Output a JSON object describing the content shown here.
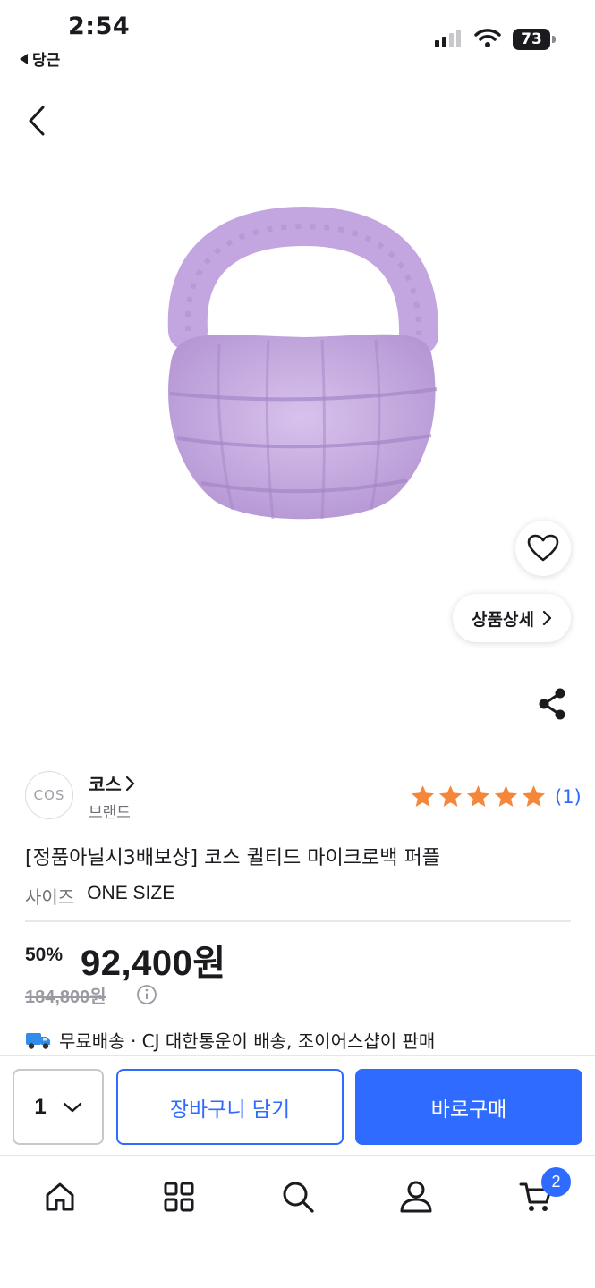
{
  "status_bar": {
    "time": "2:54",
    "back_app": "당근",
    "battery": "73"
  },
  "product": {
    "detail_label": "상품상세",
    "brand": {
      "logo_text": "COS",
      "name": "코스",
      "sub": "브랜드"
    },
    "rating": {
      "stars": 5,
      "review_count": "(1)"
    },
    "title": "[정품아닐시3배보상] 코스 퀼티드 마이크로백 퍼플",
    "size_label": "사이즈",
    "size_value": "ONE SIZE",
    "discount": "50%",
    "price": "92,400원",
    "original_price": "184,800원",
    "shipping": "무료배송 · CJ 대한통운이 배송, 조이어스샵이 판매"
  },
  "purchase_bar": {
    "quantity": "1",
    "cart_label": "장바구니 담기",
    "buy_label": "바로구매"
  },
  "tab_bar": {
    "cart_badge": "2",
    "icons": [
      "home-icon",
      "grid-icon",
      "search-icon",
      "user-icon",
      "cart-icon"
    ]
  },
  "colors": {
    "accent": "#2f6bff",
    "star": "#f5873a",
    "bag": "#c9aee0"
  }
}
